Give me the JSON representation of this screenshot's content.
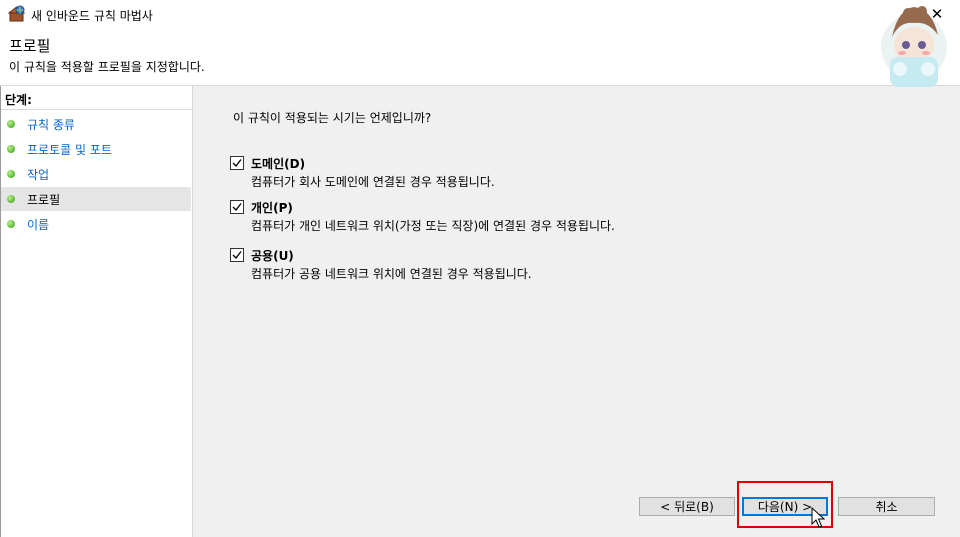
{
  "window": {
    "title": "새 인바운드 규칙 마법사",
    "close_label": "✕"
  },
  "header": {
    "title": "프로필",
    "description": "이 규칙을 적용할 프로필을 지정합니다."
  },
  "steps": {
    "title": "단계:",
    "items": [
      {
        "label": "규칙 종류"
      },
      {
        "label": "프로토콜 및 포트"
      },
      {
        "label": "작업"
      },
      {
        "label": "프로필",
        "active": true
      },
      {
        "label": "이름"
      }
    ]
  },
  "main": {
    "question": "이 규칙이 적용되는 시기는 언제입니까?",
    "options": [
      {
        "label": "도메인(D)",
        "description": "컴퓨터가 회사 도메인에 연결된 경우 적용됩니다.",
        "checked": true
      },
      {
        "label": "개인(P)",
        "description": "컴퓨터가 개인 네트워크 위치(가정 또는 직장)에 연결된 경우 적용됩니다.",
        "checked": true
      },
      {
        "label": "공용(U)",
        "description": "컴퓨터가 공용 네트워크 위치에 연결된 경우 적용됩니다.",
        "checked": true
      }
    ]
  },
  "buttons": {
    "back": "< 뒤로(B)",
    "next": "다음(N) >",
    "cancel": "취소"
  },
  "colors": {
    "link": "#0066cc",
    "highlight": "#e00000",
    "accent": "#0078d7"
  }
}
